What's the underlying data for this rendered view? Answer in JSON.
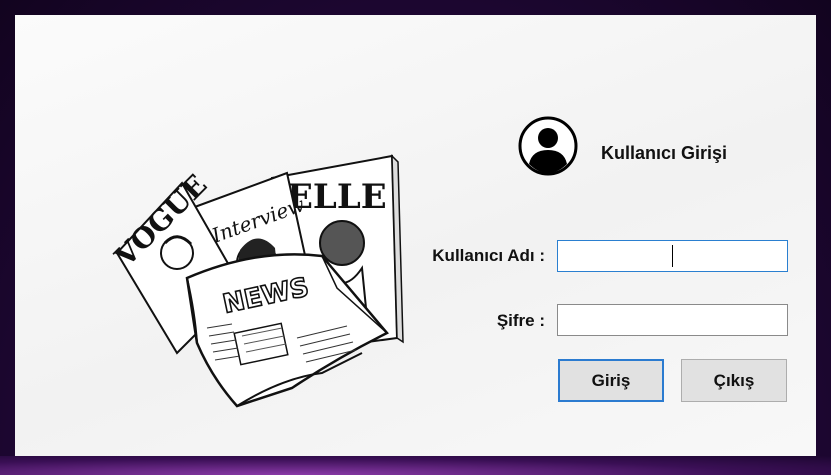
{
  "login": {
    "title": "Kullanıcı Girişi",
    "username_label": "Kullanıcı Adı :",
    "password_label": "Şifre :",
    "username_value": "",
    "password_value": "",
    "login_button": "Giriş",
    "exit_button": "Çıkış"
  },
  "illustration": {
    "magazine_left": "VOGUE",
    "magazine_middle": "Interview",
    "magazine_right": "ELLE",
    "newspaper_headline": "NEWS"
  },
  "colors": {
    "focus_border": "#2a7fd0",
    "button_bg": "#e1e1e1",
    "background_purple": "#3a0f55"
  }
}
